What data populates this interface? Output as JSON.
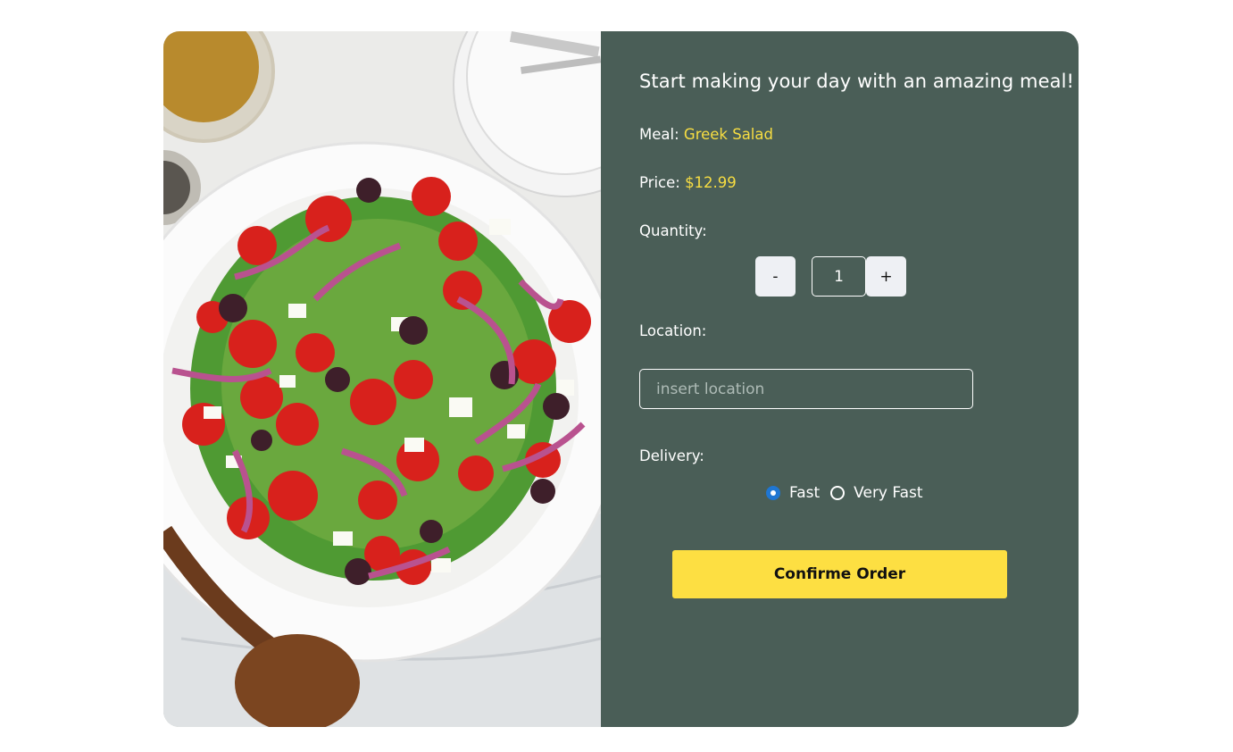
{
  "heading": "Start making your day with an amazing meal!",
  "meal": {
    "label": "Meal:",
    "value": "Greek Salad"
  },
  "price": {
    "label": "Price:",
    "value": "$12.99"
  },
  "quantity": {
    "label": "Quantity:",
    "decrement": "-",
    "value": "1",
    "increment": "+"
  },
  "location": {
    "label": "Location:",
    "placeholder": "insert location",
    "value": ""
  },
  "delivery": {
    "label": "Delivery:",
    "options": [
      {
        "label": "Fast",
        "selected": true
      },
      {
        "label": "Very Fast",
        "selected": false
      }
    ]
  },
  "confirm_button": "Confirme Order",
  "colors": {
    "panel": "#4a5e57",
    "accent_text": "#f7dd42",
    "button": "#fddf42",
    "radio_checked": "#1f76d2"
  }
}
